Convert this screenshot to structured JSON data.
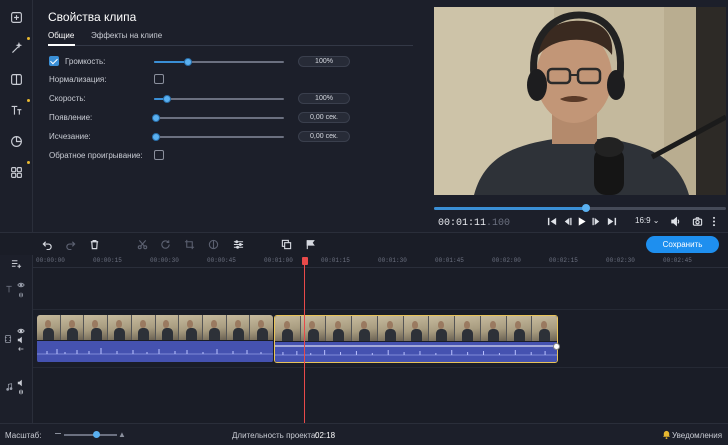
{
  "sidebar": {
    "items": [
      {
        "name": "import",
        "icon": "add-file-icon",
        "dot": false
      },
      {
        "name": "filters",
        "icon": "magic-wand-icon",
        "dot": true
      },
      {
        "name": "transitions",
        "icon": "transitions-icon",
        "dot": false
      },
      {
        "name": "titles",
        "icon": "titles-icon",
        "dot": true
      },
      {
        "name": "stickers",
        "icon": "stickers-icon",
        "dot": false
      },
      {
        "name": "more",
        "icon": "grid-icon",
        "dot": true
      }
    ]
  },
  "props": {
    "title": "Свойства клипа",
    "tabs": [
      "Общие",
      "Эффекты на клипе"
    ],
    "rows": [
      {
        "label": "Громкость:",
        "checkbox": true,
        "checked": true,
        "slider": 0.26,
        "value": "100%"
      },
      {
        "label": "Нормализация:",
        "checkbox": true,
        "checked": false
      },
      {
        "label": "Скорость:",
        "slider": 0.1,
        "value": "100%"
      },
      {
        "label": "Появление:",
        "slider": 0.0,
        "value": "0,00 сек."
      },
      {
        "label": "Исчезание:",
        "slider": 0.0,
        "value": "0,00 сек."
      },
      {
        "label": "Обратное проигрывание:",
        "checkbox": true,
        "checked": false
      }
    ]
  },
  "preview": {
    "progress": 0.52,
    "timecode_main": "00:01:11",
    "timecode_ms": ".100",
    "ratio": "16:9 ⌄"
  },
  "toolbar": {
    "save_label": "Сохранить"
  },
  "ruler": {
    "labels": [
      "00:00:00",
      "00:00:15",
      "00:00:30",
      "00:00:45",
      "00:01:00",
      "00:01:15",
      "00:01:30",
      "00:01:45",
      "00:02:00",
      "00:02:15",
      "00:02:30",
      "00:02:45"
    ]
  },
  "status": {
    "zoom_label": "Масштаб:",
    "zoom_level": 0.6,
    "duration_label": "Длительность проекта:",
    "duration_value": "02:18",
    "notifications": "Уведомления"
  },
  "colors": {
    "accent": "#1e8fef",
    "playhead": "#e84a4a",
    "audio": "#4552b0",
    "selection": "#e8c35a"
  }
}
